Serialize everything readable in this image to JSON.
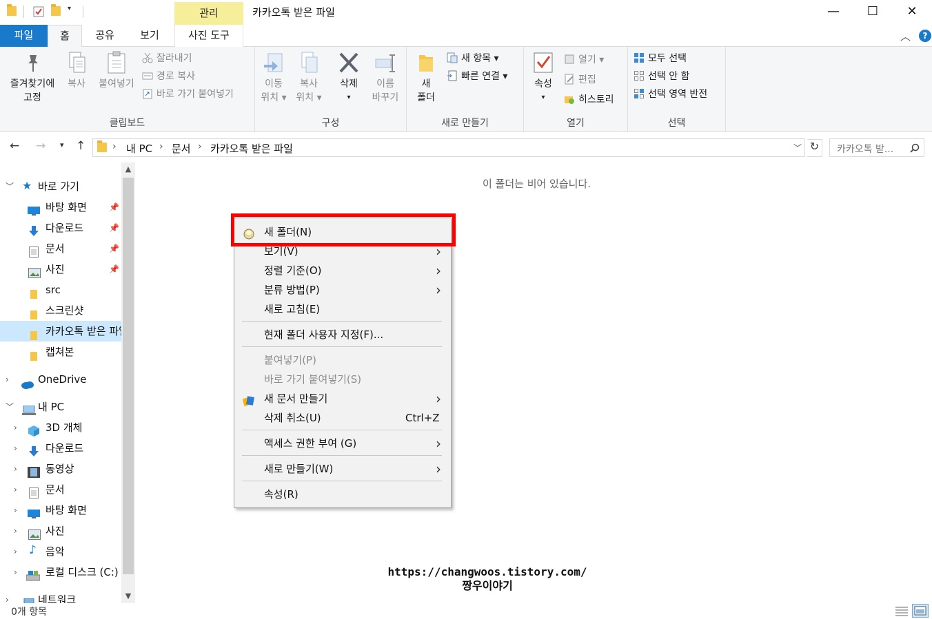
{
  "window": {
    "title": "카카오톡 받은 파일",
    "contextual_tab_group": "관리",
    "minimize": "—",
    "maximize": "☐",
    "close": "✕"
  },
  "tabs": {
    "file": "파일",
    "home": "홈",
    "share": "공유",
    "view": "보기",
    "picture_tools": "사진 도구"
  },
  "ribbon": {
    "clipboard": {
      "label": "클립보드",
      "pin_line1": "즐겨찾기에",
      "pin_line2": "고정",
      "copy": "복사",
      "paste": "붙여넣기",
      "cut": "잘라내기",
      "copy_path": "경로 복사",
      "paste_shortcut": "바로 가기 붙여넣기"
    },
    "organize": {
      "label": "구성",
      "move_line1": "이동",
      "move_line2": "위치 ▾",
      "copyto_line1": "복사",
      "copyto_line2": "위치 ▾",
      "delete": "삭제",
      "delete_arrow": "▾",
      "rename_line1": "이름",
      "rename_line2": "바꾸기"
    },
    "new": {
      "label": "새로 만들기",
      "newfolder_line1": "새",
      "newfolder_line2": "폴더",
      "new_item": "새 항목 ▾",
      "easy_access": "빠른 연결 ▾"
    },
    "open": {
      "label": "열기",
      "properties": "속성",
      "properties_arrow": "▾",
      "open": "열기 ▾",
      "edit": "편집",
      "history": "히스토리"
    },
    "select": {
      "label": "선택",
      "select_all": "모두 선택",
      "select_none": "선택 안 함",
      "invert": "선택 영역 반전"
    }
  },
  "address": {
    "crumbs": [
      "내 PC",
      "문서",
      "카카오톡 받은 파일"
    ],
    "search_placeholder": "카카오톡 받..."
  },
  "navpane": {
    "quick_access": "바로 가기",
    "qa_items": [
      "바탕 화면",
      "다운로드",
      "문서",
      "사진",
      "src",
      "스크린샷",
      "카카오톡 받은 파일",
      "캡쳐본"
    ],
    "onedrive": "OneDrive",
    "this_pc": "내 PC",
    "pc_items": [
      "3D 개체",
      "다운로드",
      "동영상",
      "문서",
      "바탕 화면",
      "사진",
      "음악",
      "로컬 디스크 (C:)"
    ],
    "network": "네트워크"
  },
  "content": {
    "empty_message": "이 폴더는 비어 있습니다.",
    "watermark_line1": "https://changwoos.tistory.com/",
    "watermark_line2": "짱우이야기"
  },
  "context_menu": {
    "new_folder": "새 폴더(N)",
    "view": "보기(V)",
    "sort_by": "정렬 기준(O)",
    "group_by": "분류 방법(P)",
    "refresh": "새로 고침(E)",
    "customize": "현재 폴더 사용자 지정(F)...",
    "paste": "붙여넣기(P)",
    "paste_shortcut": "바로 가기 붙여넣기(S)",
    "new_document": "새 문서 만들기",
    "undo_delete": "삭제 취소(U)",
    "undo_shortcut": "Ctrl+Z",
    "give_access": "액세스 권한 부여 (G)",
    "new": "새로 만들기(W)",
    "properties": "속성(R)"
  },
  "status": {
    "item_count": "0개 항목"
  },
  "colors": {
    "file_tab": "#1979ca",
    "contextual_tab": "#f6ee9b",
    "selection": "#cce8ff",
    "highlight_box": "#ff0000"
  }
}
